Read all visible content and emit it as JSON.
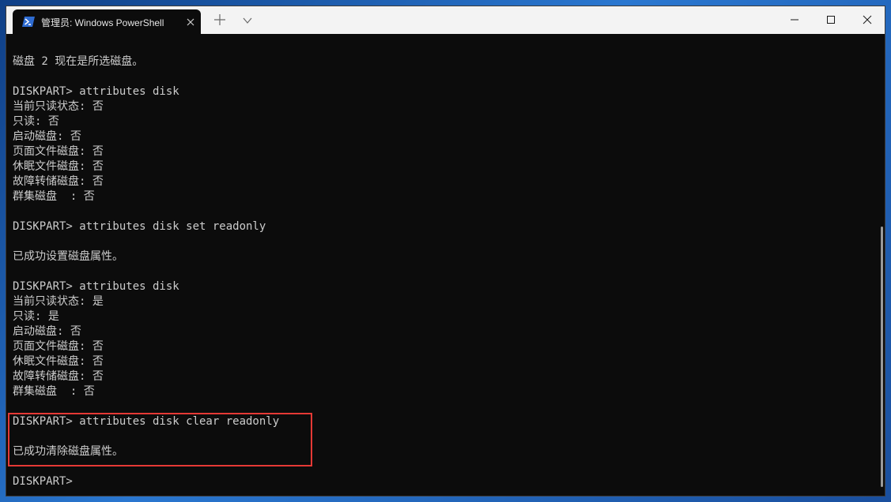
{
  "window": {
    "tab_title": "管理员: Windows PowerShell",
    "tab_icon": "powershell-icon",
    "buttons": [
      "minimize-icon",
      "maximize-icon",
      "close-icon"
    ]
  },
  "terminal": {
    "lines": [
      "磁盘 2 现在是所选磁盘。",
      "",
      "DISKPART> attributes disk",
      "当前只读状态: 否",
      "只读: 否",
      "启动磁盘: 否",
      "页面文件磁盘: 否",
      "休眠文件磁盘: 否",
      "故障转储磁盘: 否",
      "群集磁盘  : 否",
      "",
      "DISKPART> attributes disk set readonly",
      "",
      "已成功设置磁盘属性。",
      "",
      "DISKPART> attributes disk",
      "当前只读状态: 是",
      "只读: 是",
      "启动磁盘: 否",
      "页面文件磁盘: 否",
      "休眠文件磁盘: 否",
      "故障转储磁盘: 否",
      "群集磁盘  : 否",
      "",
      "DISKPART> attributes disk clear readonly",
      "",
      "已成功清除磁盘属性。",
      "",
      "DISKPART>"
    ]
  },
  "colors": {
    "terminal_background": "#0c0c0c",
    "terminal_text": "#cccccc",
    "highlight_border": "#e53935",
    "titlebar_background": "#f3f3f3"
  }
}
